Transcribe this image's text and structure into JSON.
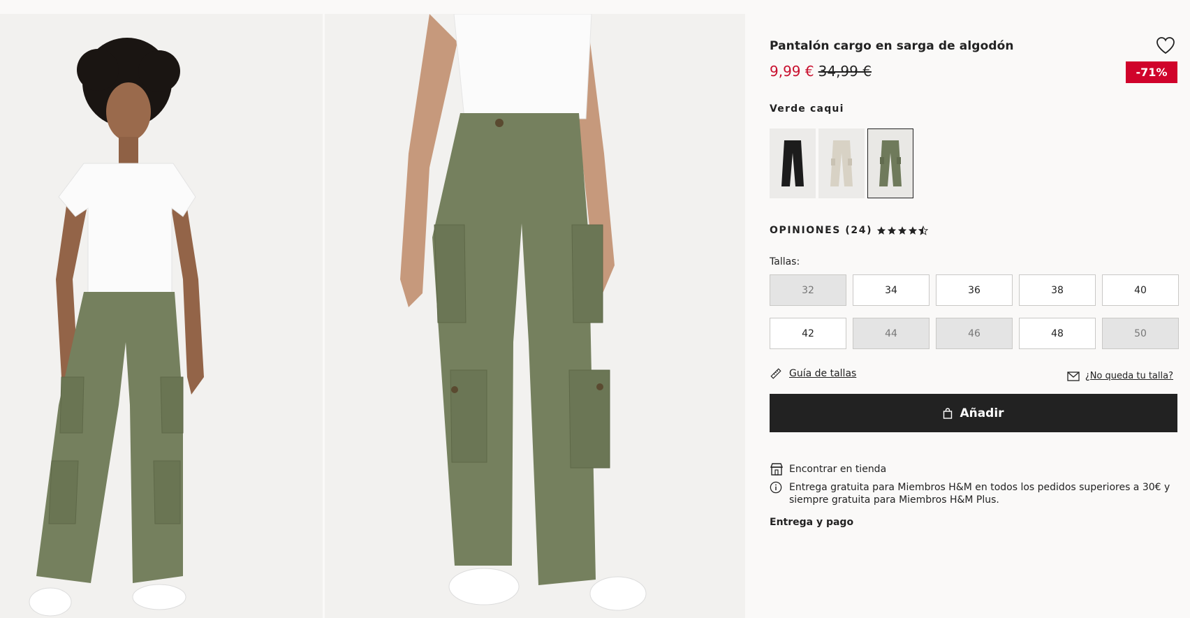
{
  "product": {
    "title": "Pantalón cargo en sarga de algodón",
    "price_sale": "9,99 €",
    "price_original": "34,99 €",
    "discount": "-71%",
    "wishlist_icon": "heart-outline-icon"
  },
  "color": {
    "name": "Verde caqui",
    "swatches": [
      {
        "label": "Negro",
        "color": "#1c1c1c"
      },
      {
        "label": "Beige",
        "color": "#d8d2c5"
      },
      {
        "label": "Verde caqui",
        "color": "#6f7a5b",
        "selected": true
      }
    ]
  },
  "reviews": {
    "label": "OPINIONES (24)",
    "rating": 4.5
  },
  "sizes": {
    "label": "Tallas:",
    "items": [
      {
        "size": "32",
        "available": false
      },
      {
        "size": "34",
        "available": true
      },
      {
        "size": "36",
        "available": true
      },
      {
        "size": "38",
        "available": true
      },
      {
        "size": "40",
        "available": true
      },
      {
        "size": "42",
        "available": true
      },
      {
        "size": "44",
        "available": false
      },
      {
        "size": "46",
        "available": false
      },
      {
        "size": "48",
        "available": true
      },
      {
        "size": "50",
        "available": false
      }
    ]
  },
  "links": {
    "size_guide": "Guía de tallas",
    "notify": "¿No queda tu talla?"
  },
  "add_button": "Añadir",
  "store": {
    "find_store": "Encontrar en tienda",
    "delivery_info": "Entrega gratuita para Miembros H&M en todos los pedidos superiores a 30€ y siempre gratuita para Miembros H&M Plus.",
    "delivery_payment": "Entrega y pago"
  },
  "colors": {
    "sale": "#c8102e",
    "badge": "#d0032b",
    "button": "#222222",
    "pants": "#75805e"
  }
}
